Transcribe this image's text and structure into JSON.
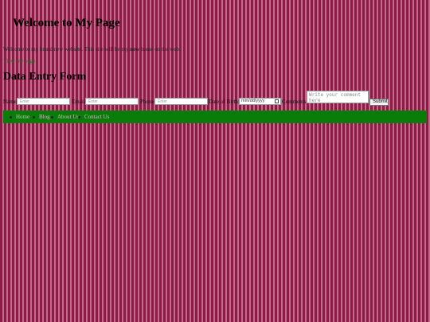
{
  "header": {
    "title": "Welcome to My Page"
  },
  "intro": {
    "text_before": "Welcome to my brand new website. This site will be my ",
    "text_emphasis": "new",
    "text_after": " home on the web."
  },
  "view_link": {
    "label": "View my page"
  },
  "form": {
    "title": "Data Entry Form",
    "fields": [
      {
        "label": "Name:",
        "placeholder": "Enter"
      },
      {
        "label": "Email:",
        "placeholder": "Enter"
      },
      {
        "label": "Phone:",
        "placeholder": "Enter"
      }
    ],
    "dob": {
      "label": "Date of Birth:",
      "placeholder": "mm/dd/yyyy"
    },
    "comment": {
      "label": "Comments:",
      "placeholder": "Write your comment here"
    },
    "submit_label": "Submit"
  },
  "nav": {
    "items": [
      {
        "label": "Home"
      },
      {
        "label": "Blog"
      },
      {
        "label": "About Us"
      },
      {
        "label": "Contact Us"
      }
    ]
  },
  "colors": {
    "background_stripe_dark": "#8a1c45",
    "background_stripe_light": "#c56a8a",
    "nav_background": "#0a7c0a",
    "link_green": "#1e6f2a",
    "nav_text": "#d9b3c4"
  }
}
